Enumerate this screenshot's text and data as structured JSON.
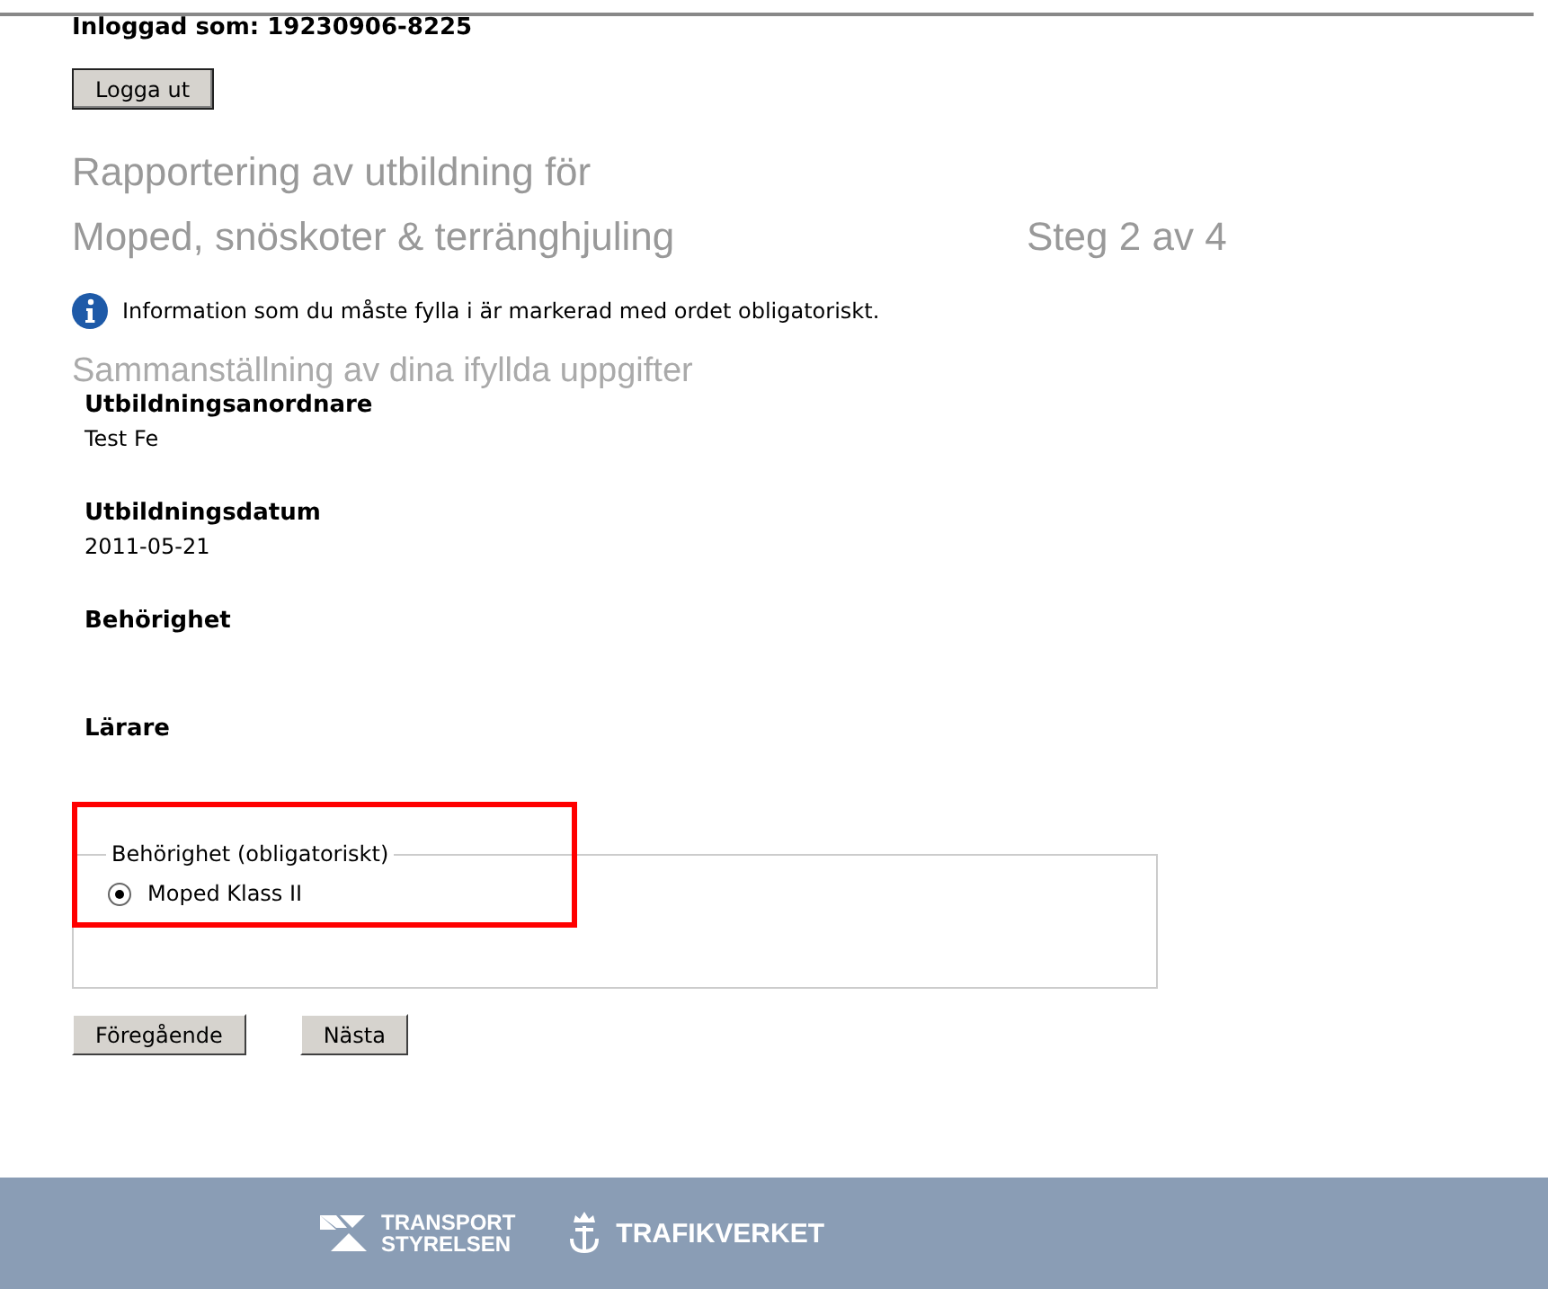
{
  "logged_in": "Inloggad som: 19230906-8225",
  "logout_button": "Logga ut",
  "title_lines": [
    "Rapportering av utbildning för",
    "Moped, snöskoter & terränghjuling"
  ],
  "step": "Steg 2 av 4",
  "info": "Information som du måste fylla i är markerad med ordet obligatoriskt.",
  "summary_heading": "Sammanställning av dina ifyllda uppgifter",
  "fields": [
    {
      "label": "Utbildningsanordnare",
      "value": "Test Fe"
    },
    {
      "label": "Utbildningsdatum",
      "value": "2011-05-21"
    },
    {
      "label": "Behörighet"
    },
    {
      "label": "Lärare"
    }
  ],
  "fieldset": {
    "legend": "Behörighet (obligatoriskt)",
    "highlighted": true,
    "options": [
      {
        "label": "Moped Klass II",
        "selected": true
      }
    ]
  },
  "buttons": [
    "Föregående",
    "Nästa"
  ],
  "footer": {
    "logo_1": [
      "TRANSPORT",
      "STYRELSEN"
    ],
    "logo_2": "TRAFIKVERKET"
  }
}
